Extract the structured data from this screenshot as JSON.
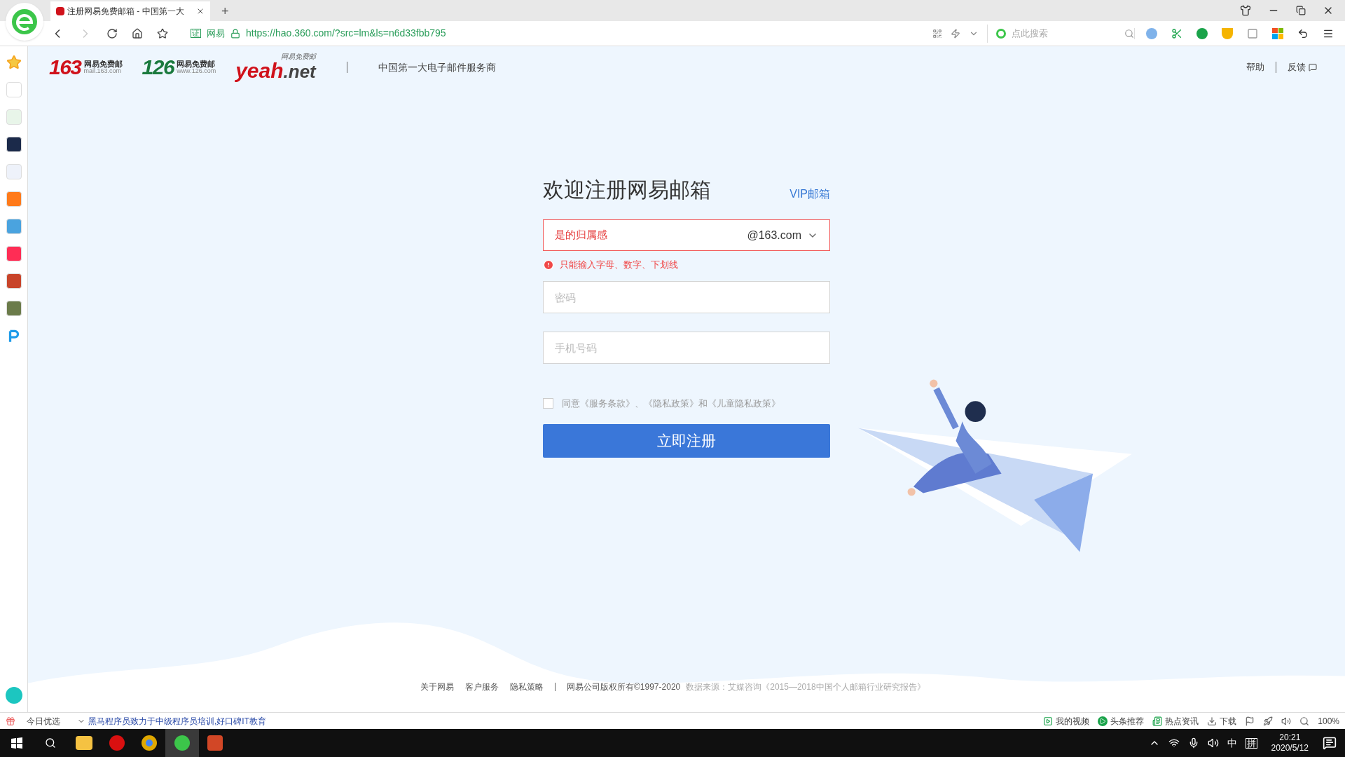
{
  "browser": {
    "tab_title": "注册网易免费邮箱 - 中国第一大",
    "new_tab": "+",
    "cert_badge": "证",
    "site_name": "网易",
    "url": "https://hao.360.com/?src=lm&ls=n6d33fbb795",
    "search_placeholder": "点此搜索"
  },
  "header": {
    "logos": [
      {
        "kind": "number",
        "mark": "163",
        "name": "网易免费邮",
        "domain": "mail.163.com",
        "color": "#d0121b"
      },
      {
        "kind": "number",
        "mark": "126",
        "name": "网易免费邮",
        "domain": "www.126.com",
        "color": "#1b7a3e"
      },
      {
        "kind": "yeah",
        "mark": "yeah",
        "suffix": ".net",
        "name": "网易免费邮",
        "color": "#d0121b"
      }
    ],
    "slogan": "中国第一大电子邮件服务商",
    "links": [
      "帮助",
      "反馈"
    ]
  },
  "form": {
    "title": "欢迎注册网易邮箱",
    "vip_link": "VIP邮箱",
    "username": {
      "value": "是的归属感",
      "suffix": "@163.com",
      "invalid": true
    },
    "error": "只能输入字母、数字、下划线",
    "password": {
      "placeholder": "密码"
    },
    "phone": {
      "placeholder": "手机号码"
    },
    "agreement": {
      "checked": false,
      "text": "同意《服务条款》、《隐私政策》和《儿童隐私政策》"
    },
    "submit": "立即注册"
  },
  "footer": {
    "links": [
      "关于网易",
      "客户服务",
      "隐私策略"
    ],
    "copyright": "网易公司版权所有©1997-2020",
    "source": "数据来源：艾媒咨询《2015—2018中国个人邮箱行业研究报告》"
  },
  "status_bar": {
    "left_label": "今日优选",
    "news": "黑马程序员致力于中级程序员培训,好口碑IT教育",
    "items": [
      {
        "kind": "video",
        "label": "我的视频"
      },
      {
        "kind": "play",
        "label": "头条推荐"
      },
      {
        "kind": "news",
        "label": "热点资讯"
      },
      {
        "kind": "download",
        "label": "下载"
      }
    ],
    "zoom": "100%"
  },
  "taskbar": {
    "ime": "中",
    "ime_mode": "拼",
    "time": "20:21",
    "date": "2020/5/12"
  }
}
